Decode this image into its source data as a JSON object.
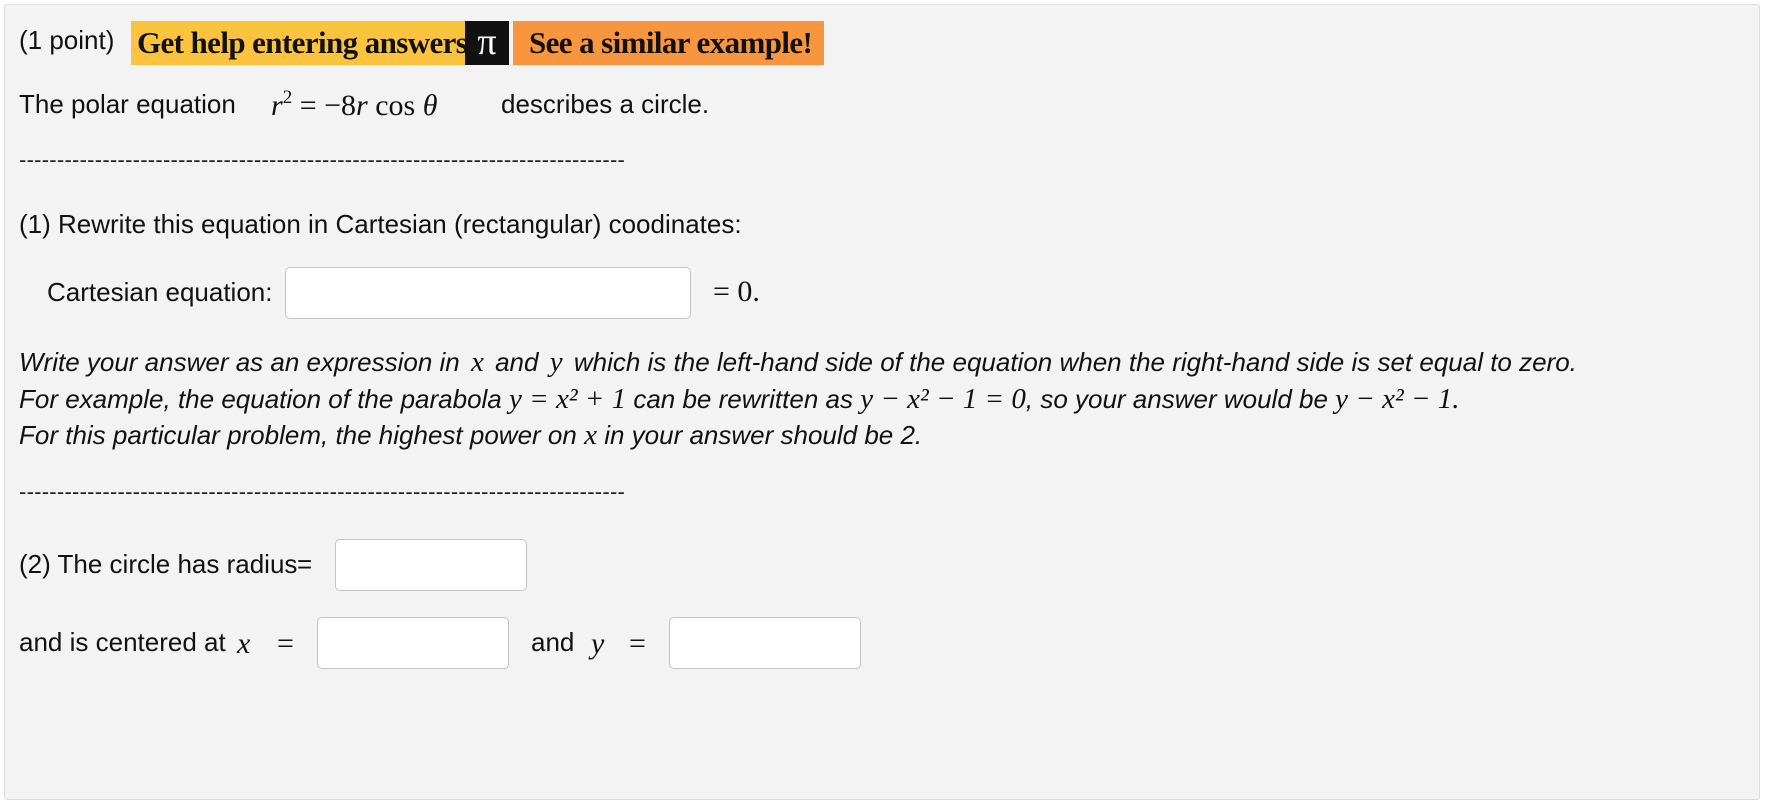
{
  "header": {
    "points": "(1 point)",
    "help_label": "Get help entering answers",
    "pi_glyph": "π",
    "example_label": "See a similar example!",
    "colors": {
      "help_bg": "#fcc33e",
      "example_bg": "#f7963e",
      "pi_bg": "#111111"
    }
  },
  "intro": {
    "text_before": "The polar equation",
    "equation": {
      "lhs_var": "r",
      "lhs_exp": "2",
      "rhs": "= −8",
      "rhs_var": "r",
      "cos": "cos",
      "theta": "θ"
    },
    "text_after": "describes a circle."
  },
  "separator": "--------------------------------------------------------------------------------",
  "part1": {
    "prompt": "(1) Rewrite this equation in Cartesian (rectangular) coodinates:",
    "field_label": "Cartesian equation:",
    "field_value": "",
    "field_suffix": "= 0.",
    "note": {
      "l1_a": "Write your answer as an expression in",
      "l1_x": "x",
      "l1_b": "and",
      "l1_y": "y",
      "l1_c": "which is the left-hand side of the equation when the right-hand side is set equal to zero.",
      "l2_a": "For example, the equation of the parabola",
      "l2_m1": "y = x² + 1",
      "l2_b": "can be rewritten as",
      "l2_m2": "y − x² − 1 = 0",
      "l2_c": ", so your answer would be",
      "l2_m3": "y − x² − 1.",
      "l3_a": "For this particular problem, the highest power on",
      "l3_x": "x",
      "l3_b": "in your answer should be 2."
    }
  },
  "part2": {
    "radius_label": "(2) The circle has radius",
    "radius_eq": "=",
    "radius_value": "",
    "center_label": "and is centered at",
    "x_var": "x",
    "eq": "=",
    "x_value": "",
    "and_label": "and",
    "y_var": "y",
    "y_value": ""
  }
}
